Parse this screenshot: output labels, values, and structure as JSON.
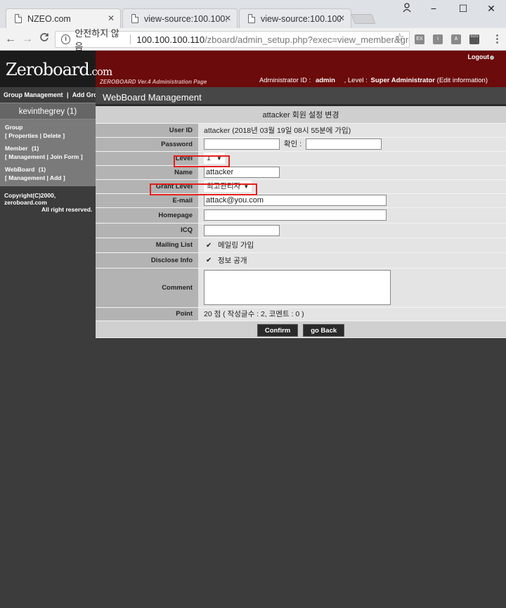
{
  "browser": {
    "tabs": [
      {
        "title": "NZEO.com",
        "close": "✕"
      },
      {
        "title": "view-source:100.100.100",
        "close": "✕"
      },
      {
        "title": "view-source:100.100.100",
        "close": "✕"
      }
    ],
    "window": {
      "minimize": "−",
      "maximize": "☐",
      "close": "✕"
    },
    "nav": {
      "back": "←",
      "forward": "→",
      "reload": "C"
    },
    "address": {
      "security_label": "안전하지 않음",
      "host": "100.100.100.110",
      "path": "/zboard/admin_setup.php?exec=view_member&gro..."
    },
    "extensions": [
      {
        "name": "ex-extension-icon",
        "color": "#8a8a8a",
        "text": "EX"
      },
      {
        "name": "info-extension-icon",
        "color": "#8a8a8a",
        "text": "i"
      },
      {
        "name": "pdf-extension-icon",
        "color": "#8a8a8a",
        "text": "A"
      },
      {
        "name": "binary-extension-icon",
        "color": "#555555",
        "text": "0101"
      }
    ]
  },
  "header": {
    "logo_main": "Zeroboard",
    "logo_suffix": ".com",
    "logout": "Logout",
    "version": "ZEROBOARD Ver.4 Administration Page",
    "admin_id_label": "Administrator ID :",
    "admin_id": "admin",
    "level_label": ", Level :",
    "level_value": "Super Administrator",
    "edit_info": "(Edit information)"
  },
  "sidebar": {
    "group_management": "Group Management",
    "separator": "|",
    "add_group": "Add Group",
    "group_name": "kevinthegrey (1)",
    "group_label": "Group",
    "group_links": "[ Properties | Delete ]",
    "member_label": "Member",
    "member_count": "(1)",
    "member_links": "[ Management | Join Form ]",
    "webboard_label": "WebBoard",
    "webboard_count": "(1)",
    "webboard_links": "[ Management | Add ]",
    "copyright_1": "Copyright(C)2000, zeroboard.com",
    "copyright_2": "All right reserved."
  },
  "main": {
    "title": "WebBoard Management",
    "caption": "attacker 회원 설정 변경",
    "fields": {
      "user_id_label": "User ID",
      "user_id_value": "attacker  (2018년 03월 19일 08시 55분에 가입)",
      "password_label": "Password",
      "confirm_label": "확인 :",
      "level_label": "Level",
      "level_value": "1",
      "name_label": "Name",
      "name_value": "attacker",
      "grant_label": "Grant Level",
      "grant_value": "최고관리자",
      "email_label": "E-mail",
      "email_value": "attack@you.com",
      "homepage_label": "Homepage",
      "homepage_value": "",
      "icq_label": "ICQ",
      "icq_value": "",
      "mailing_label": "Mailing List",
      "mailing_text": "메일링 가입",
      "disclose_label": "Disclose Info",
      "disclose_text": "정보 공개",
      "comment_label": "Comment",
      "point_label": "Point",
      "point_value": "20 점 ( 작성글수 : 2, 코멘트 : 0 )"
    },
    "confirm_button": "Confirm",
    "back_button": "go Back"
  },
  "colors": {
    "banner": "#6b0b0b",
    "highlight": "#e0201c"
  }
}
